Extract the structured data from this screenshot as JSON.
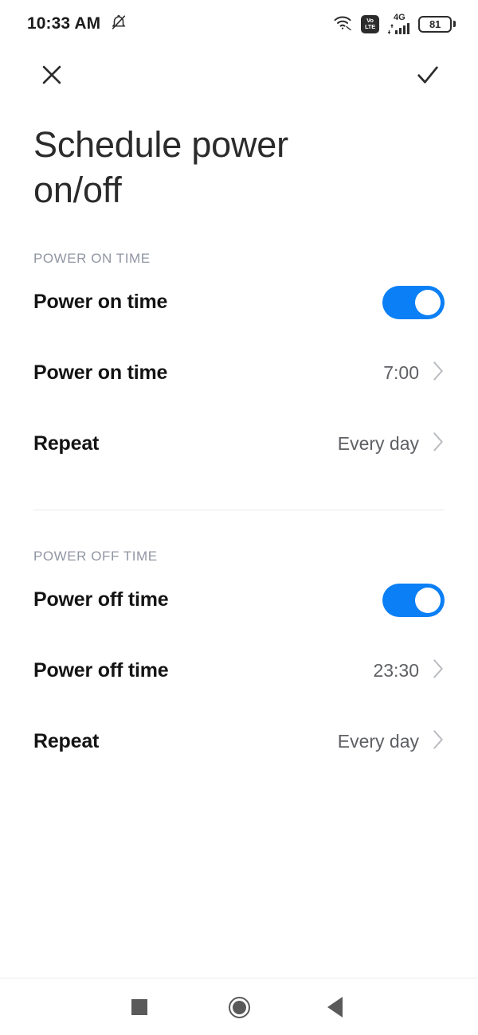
{
  "status_bar": {
    "time": "10:33 AM",
    "notification_icon": "bell-off-icon",
    "wifi_icon": "wifi-icon",
    "volte_top": "Vo",
    "volte_bottom": "LTE",
    "network_type": "4G",
    "signal_icon": "signal-bars-icon",
    "battery_level": "81"
  },
  "app_bar": {
    "close_icon": "close-icon",
    "confirm_icon": "check-icon"
  },
  "page": {
    "title": "Schedule power on/off"
  },
  "sections": [
    {
      "header": "POWER ON TIME",
      "rows": [
        {
          "label": "Power on time",
          "control": "toggle",
          "toggle_state": "on"
        },
        {
          "label": "Power on time",
          "control": "value",
          "value": "7:00"
        },
        {
          "label": "Repeat",
          "control": "value",
          "value": "Every day"
        }
      ]
    },
    {
      "header": "POWER OFF TIME",
      "rows": [
        {
          "label": "Power off time",
          "control": "toggle",
          "toggle_state": "on"
        },
        {
          "label": "Power off time",
          "control": "value",
          "value": "23:30"
        },
        {
          "label": "Repeat",
          "control": "value",
          "value": "Every day"
        }
      ]
    }
  ],
  "nav_bar": {
    "recents_icon": "recents-square-icon",
    "home_icon": "home-circle-icon",
    "back_icon": "back-triangle-icon"
  },
  "colors": {
    "accent_blue": "#0b7ff5",
    "section_header_gray": "#9096a3",
    "value_gray": "#5e6064",
    "chevron_gray": "#b8bbbf",
    "divider": "#e9eaec"
  }
}
